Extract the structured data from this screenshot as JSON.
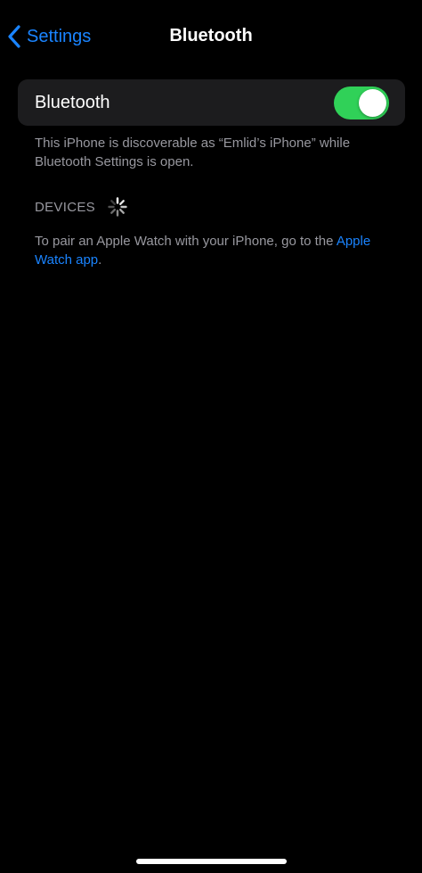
{
  "colors": {
    "background": "#000000",
    "card": "#1c1c1e",
    "accent": "#1a84ff",
    "toggle_on": "#30d158",
    "secondary_text": "#98989f"
  },
  "nav": {
    "back_icon": "chevron-left-icon",
    "back_label": "Settings",
    "title": "Bluetooth"
  },
  "bluetooth_toggle": {
    "label": "Bluetooth",
    "state": "on"
  },
  "discoverable_note": "This iPhone is discoverable as “Emlid’s iPhone” while Bluetooth Settings is open.",
  "devices": {
    "header": "DEVICES",
    "loading_icon": "spinner-icon"
  },
  "apple_watch_note": {
    "text": "To pair an Apple Watch with your iPhone, go to the ",
    "link": "Apple Watch app",
    "suffix": "."
  }
}
